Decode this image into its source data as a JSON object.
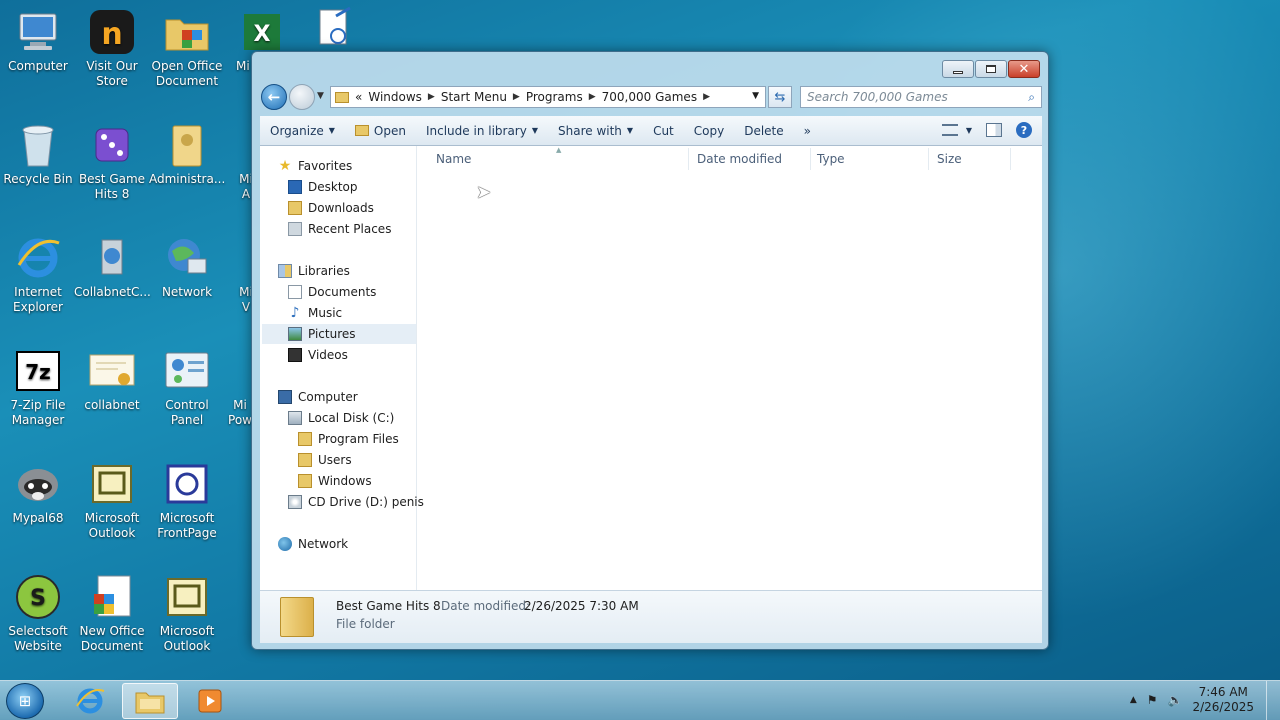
{
  "desktop": {
    "icons": [
      {
        "label": "Computer",
        "icon": "computer-icon"
      },
      {
        "label": "Visit Our Store",
        "icon": "store-icon"
      },
      {
        "label": "Open Office Document",
        "icon": "office-doc-icon"
      },
      {
        "label": "Mi",
        "icon": "excel-icon"
      },
      {
        "label": "Recycle Bin",
        "icon": "recycle-bin-icon"
      },
      {
        "label": "Best Game Hits 8",
        "icon": "dice-icon"
      },
      {
        "label": "Administra...",
        "icon": "user-folder-icon"
      },
      {
        "label": "Mi A",
        "icon": "access-icon"
      },
      {
        "label": "Internet Explorer",
        "icon": "ie-icon"
      },
      {
        "label": "CollabnetC...",
        "icon": "collabnet-icon"
      },
      {
        "label": "Network",
        "icon": "network-icon"
      },
      {
        "label": "Mi V",
        "icon": "word-icon"
      },
      {
        "label": "7-Zip File Manager",
        "icon": "7zip-icon"
      },
      {
        "label": "collabnet",
        "icon": "certificate-icon"
      },
      {
        "label": "Control Panel",
        "icon": "control-panel-icon"
      },
      {
        "label": "Mi Pow",
        "icon": "powerpoint-icon"
      },
      {
        "label": "Mypal68",
        "icon": "raccoon-icon"
      },
      {
        "label": "Microsoft Outlook",
        "icon": "outlook-icon"
      },
      {
        "label": "Microsoft FrontPage",
        "icon": "frontpage-icon"
      },
      {
        "label": "Selectsoft Website",
        "icon": "selectsoft-icon"
      },
      {
        "label": "New Office Document",
        "icon": "new-office-doc-icon"
      },
      {
        "label": "Microsoft Outlook",
        "icon": "outlook-icon"
      }
    ]
  },
  "explorer": {
    "address": {
      "overflow": "«",
      "crumbs": [
        "Windows",
        "Start Menu",
        "Programs",
        "700,000 Games"
      ]
    },
    "search_placeholder": "Search 700,000 Games",
    "toolbar": {
      "organize": "Organize",
      "open": "Open",
      "include_in_library": "Include in library",
      "share_with": "Share with",
      "cut": "Cut",
      "copy": "Copy",
      "delete": "Delete",
      "more": "»"
    },
    "nav": {
      "favorites": "Favorites",
      "desktop": "Desktop",
      "downloads": "Downloads",
      "recent_places": "Recent Places",
      "libraries": "Libraries",
      "documents": "Documents",
      "music": "Music",
      "pictures": "Pictures",
      "videos": "Videos",
      "computer": "Computer",
      "local_disk": "Local Disk (C:)",
      "program_files": "Program Files",
      "users": "Users",
      "windows": "Windows",
      "cd_drive": "CD Drive (D:) penis",
      "network": "Network"
    },
    "columns": {
      "name": "Name",
      "date_modified": "Date modified",
      "type": "Type",
      "size": "Size"
    },
    "details": {
      "name": "Best Game Hits 8",
      "date_modified_label": "Date modified:",
      "date_modified_value": "2/26/2025 7:30 AM",
      "type": "File folder"
    }
  },
  "taskbar": {
    "time": "7:46 AM",
    "date": "2/26/2025"
  }
}
